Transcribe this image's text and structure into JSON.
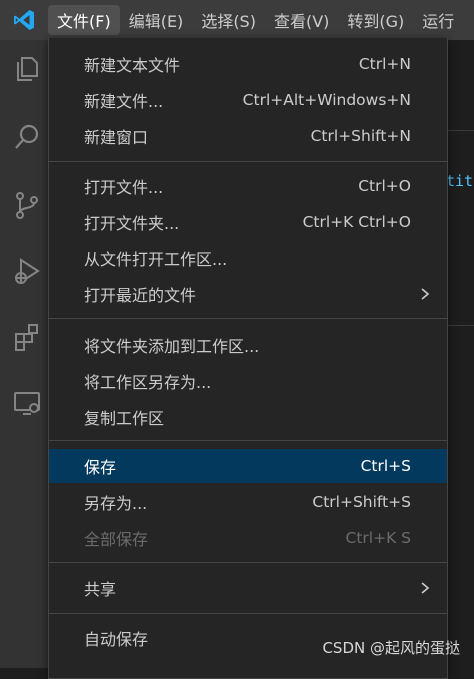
{
  "menubar": {
    "menus": [
      {
        "label": "文件(F)",
        "active": true
      },
      {
        "label": "编辑(E)"
      },
      {
        "label": "选择(S)"
      },
      {
        "label": "查看(V)"
      },
      {
        "label": "转到(G)"
      },
      {
        "label": "运行"
      }
    ]
  },
  "activity_icons": [
    "explorer-icon",
    "search-icon",
    "source-control-icon",
    "run-debug-icon",
    "extensions-icon",
    "remote-explorer-icon"
  ],
  "editor": {
    "code_fragment": "tit"
  },
  "file_menu": {
    "items": [
      {
        "label": "新建文本文件",
        "shortcut": "Ctrl+N"
      },
      {
        "label": "新建文件...",
        "shortcut": "Ctrl+Alt+Windows+N"
      },
      {
        "label": "新建窗口",
        "shortcut": "Ctrl+Shift+N"
      },
      {
        "label": "打开文件...",
        "shortcut": "Ctrl+O"
      },
      {
        "label": "打开文件夹...",
        "shortcut": "Ctrl+K Ctrl+O"
      },
      {
        "label": "从文件打开工作区..."
      },
      {
        "label": "打开最近的文件",
        "submenu": true
      },
      {
        "label": "将文件夹添加到工作区..."
      },
      {
        "label": "将工作区另存为..."
      },
      {
        "label": "复制工作区"
      },
      {
        "label": "保存",
        "shortcut": "Ctrl+S",
        "selected": true
      },
      {
        "label": "另存为...",
        "shortcut": "Ctrl+Shift+S"
      },
      {
        "label": "全部保存",
        "shortcut": "Ctrl+K S",
        "disabled": true
      },
      {
        "label": "共享",
        "submenu": true
      },
      {
        "label": "自动保存"
      }
    ]
  },
  "watermark": "CSDN @起风的蛋挞",
  "colors": {
    "titlebar": "#3c3c3c",
    "activitybar": "#333333",
    "menu_bg": "#252526",
    "selection": "#04395e",
    "vscode_blue": "#23a9f2"
  }
}
